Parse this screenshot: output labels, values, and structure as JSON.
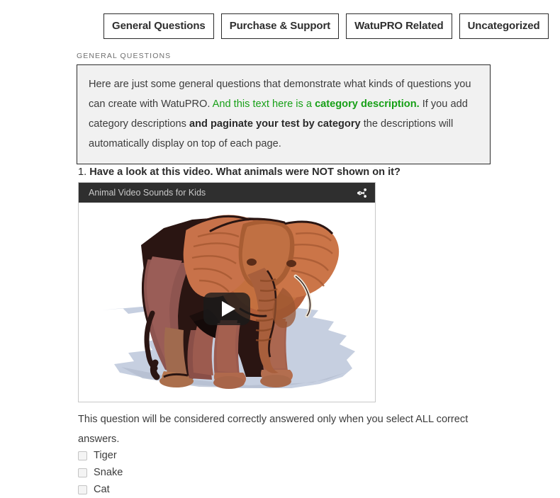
{
  "tabs": [
    {
      "label": "General Questions",
      "active": true
    },
    {
      "label": "Purchase & Support",
      "active": false
    },
    {
      "label": "WatuPRO Related",
      "active": false
    },
    {
      "label": "Uncategorized",
      "active": false
    }
  ],
  "category": {
    "label": "GENERAL QUESTIONS",
    "description": {
      "part1": "Here are just some general questions that demonstrate what kinds of questions you can create with WatuPRO. ",
      "green_plain": "And this text here is a ",
      "green_bold": "category description.",
      "part2": " If you add category descriptions ",
      "bold2": "and paginate your test by category",
      "part3": " the descriptions will automatically display on top of each page."
    }
  },
  "question": {
    "number": "1. ",
    "text": "Have a look at this video. What animals were NOT shown on it?",
    "note": "This question will be considered correctly answered only when you select ALL correct answers."
  },
  "video": {
    "title": "Animal Video Sounds for Kids",
    "share_icon": "share-icon",
    "play_icon": "play-icon"
  },
  "answers": [
    {
      "label": "Tiger",
      "checked": false
    },
    {
      "label": "Snake",
      "checked": false
    },
    {
      "label": "Cat",
      "checked": false
    }
  ],
  "colors": {
    "accent_green": "#18a018",
    "box_bg": "#f1f1f1",
    "box_border": "#2b2b2b",
    "video_bar": "#2f2f2f"
  }
}
